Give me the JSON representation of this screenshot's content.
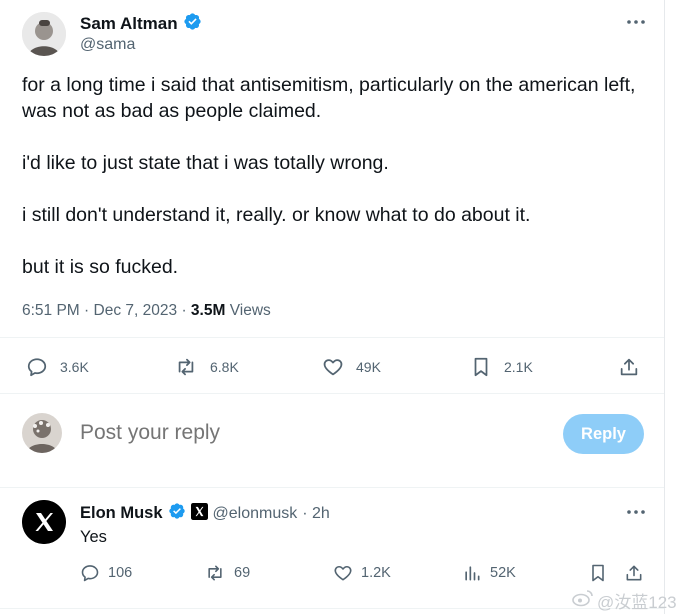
{
  "tweet": {
    "author_name": "Sam Altman",
    "author_handle": "@sama",
    "paragraphs": [
      "for a long time i said that antisemitism, particularly on the american left, was not as bad as people claimed.",
      "i'd like to just state that i was totally wrong.",
      "i still don't understand it, really. or know what to do about it.",
      "but it is so fucked."
    ],
    "time": "6:51 PM",
    "date": "Dec 7, 2023",
    "views_count": "3.5M",
    "views_label": "Views",
    "separator": "·",
    "actions": {
      "replies": "3.6K",
      "reposts": "6.8K",
      "likes": "49K",
      "bookmarks": "2.1K"
    }
  },
  "composer": {
    "placeholder": "Post your reply",
    "button_label": "Reply"
  },
  "reply": {
    "author_name": "Elon Musk",
    "author_handle": "@elonmusk",
    "time_ago": "· 2h",
    "text": "Yes",
    "actions": {
      "replies": "106",
      "reposts": "69",
      "likes": "1.2K",
      "views": "52K"
    }
  },
  "watermark": "@汝蓝123",
  "colors": {
    "verified": "#1d9bf0",
    "reply_button": "#8ecdf8",
    "muted_text": "#536471"
  },
  "icons": [
    "verified-badge-icon",
    "more-icon",
    "reply-icon",
    "repost-icon",
    "like-icon",
    "bookmark-icon",
    "share-icon",
    "views-icon",
    "x-logo-icon"
  ]
}
